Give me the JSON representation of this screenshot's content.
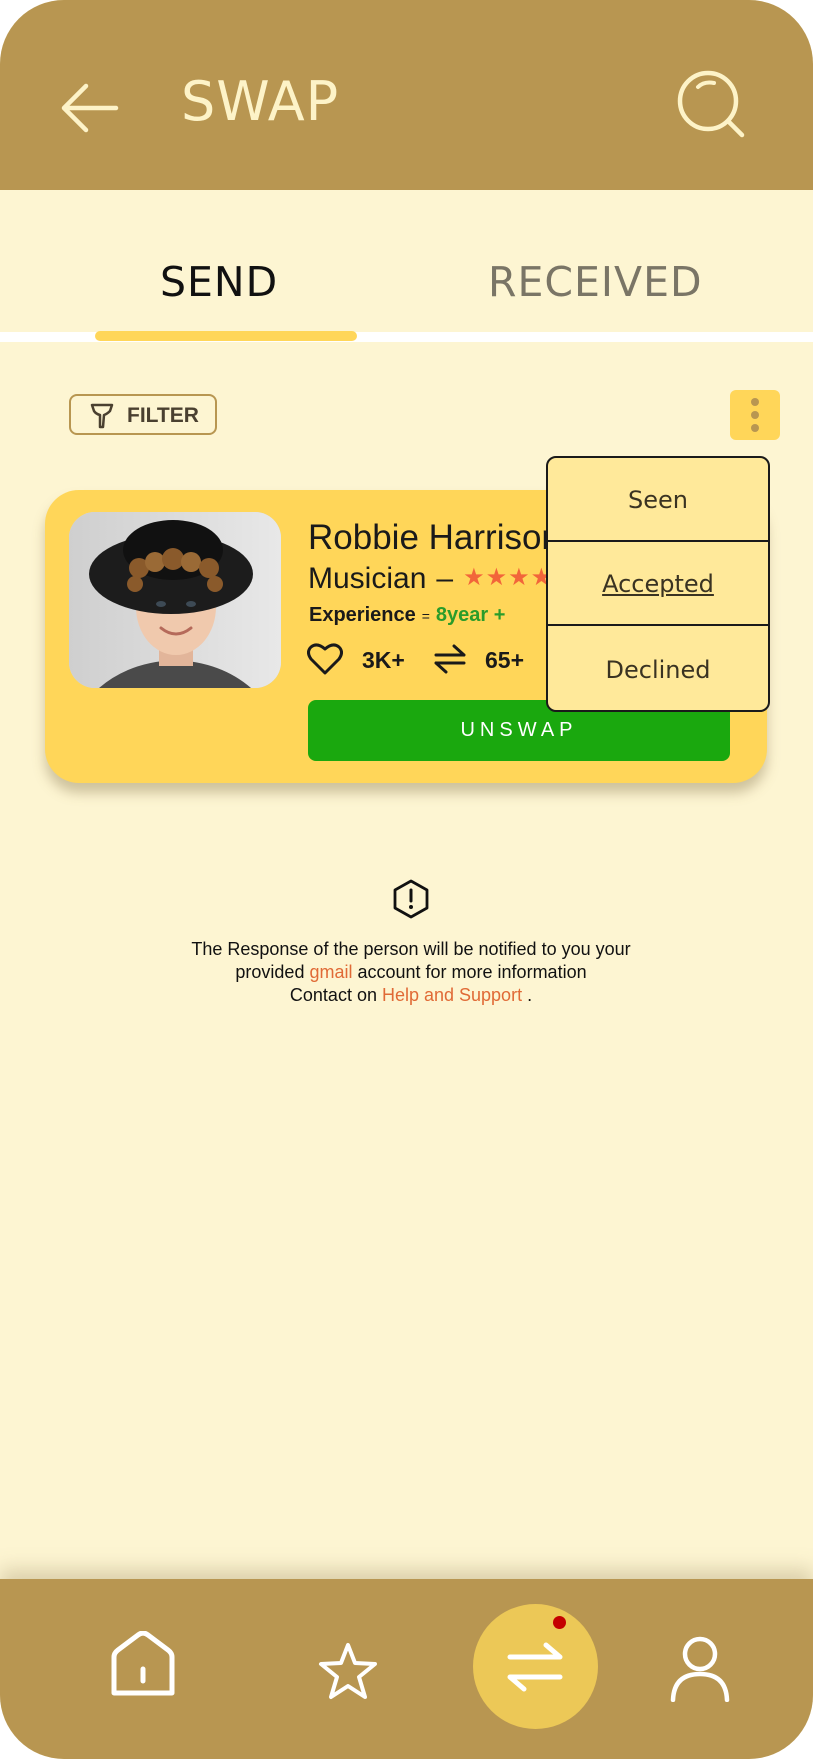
{
  "header": {
    "title": "SWAP"
  },
  "tabs": [
    {
      "label": "SEND",
      "active": true
    },
    {
      "label": "RECEIVED",
      "active": false
    }
  ],
  "filter": {
    "label": "FILTER"
  },
  "card": {
    "name": "Robbie Harrison",
    "role": "Musician",
    "role_dash": "–",
    "stars": "★★★★",
    "experience_label": "Experience",
    "experience_sep": "=",
    "experience_value": "8year +",
    "likes": "3K+",
    "swaps": "65+",
    "unswap_label": "UNSWAP"
  },
  "dropdown": {
    "items": [
      {
        "label": "Seen"
      },
      {
        "label": "Accepted"
      },
      {
        "label": "Declined"
      }
    ]
  },
  "info": {
    "line1": "The Response of the person will be notified to you your",
    "line2_pre": "provided ",
    "line2_link": "gmail",
    "line2_post": " account for more information",
    "line3_pre": "Contact on ",
    "line3_link": "Help and Support",
    "line3_post": " ."
  },
  "colors": {
    "header_bg": "#b89651",
    "page_bg": "#fdf5d2",
    "accent_yellow": "#ffd659",
    "unswap_green": "#1aa80e",
    "star_orange": "#f2653a",
    "link_orange": "#e06a36",
    "notification_red": "#c40000"
  },
  "icons": {
    "back": "arrow-left-icon",
    "search": "search-icon",
    "filter": "filter-icon",
    "more": "more-vertical-icon",
    "like": "heart-icon",
    "swap": "swap-arrows-icon",
    "info": "alert-hexagon-icon",
    "home": "home-icon",
    "favorites": "star-icon",
    "profile": "user-icon"
  }
}
